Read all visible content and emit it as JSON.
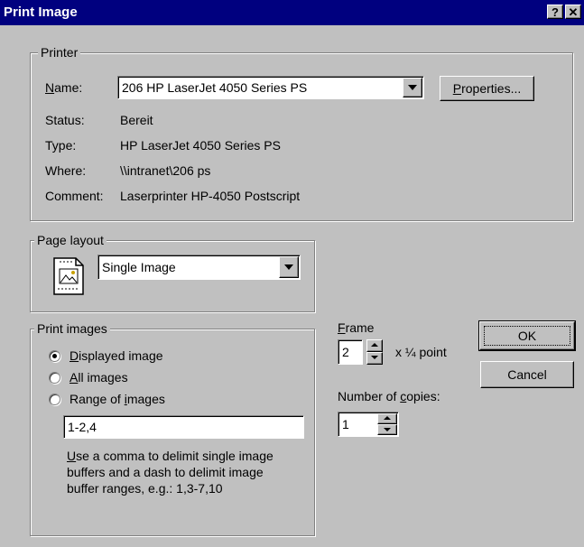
{
  "window": {
    "title": "Print Image",
    "help_glyph": "?",
    "close_glyph": "✕"
  },
  "printer": {
    "legend": "Printer",
    "name_label_u": "N",
    "name_label_rest": "ame:",
    "name_value": "206 HP LaserJet 4050 Series PS",
    "properties_u": "P",
    "properties_rest": "roperties...",
    "status_label": "Status:",
    "status_value": "Bereit",
    "type_label": "Type:",
    "type_value": "HP LaserJet 4050 Series PS",
    "where_label": "Where:",
    "where_value": "\\\\intranet\\206 ps",
    "comment_label": "Comment:",
    "comment_value": "Laserprinter HP-4050 Postscript"
  },
  "page_layout": {
    "legend": "Page layout",
    "value": "Single Image",
    "icon": "single-image-layout-icon"
  },
  "print_images": {
    "legend": "Print images",
    "options": [
      {
        "u": "D",
        "rest": "isplayed image",
        "selected": true
      },
      {
        "u": "A",
        "rest": "ll images",
        "selected": false
      },
      {
        "pre": "Range of ",
        "u": "i",
        "rest": "mages",
        "selected": false
      }
    ],
    "range_value": "1-2,4",
    "hint_u": "U",
    "hint_line1_rest": "se a comma to delimit single image",
    "hint_line2": "buffers and a dash to delimit image",
    "hint_line3": "buffer ranges, e.g.: 1,3-7,10"
  },
  "frame": {
    "label_u": "F",
    "label_rest": "rame",
    "value": "2",
    "unit": "x ¼ point"
  },
  "copies": {
    "label_pre": "Number of ",
    "label_u": "c",
    "label_rest": "opies:",
    "value": "1"
  },
  "buttons": {
    "ok": "OK",
    "cancel": "Cancel"
  }
}
